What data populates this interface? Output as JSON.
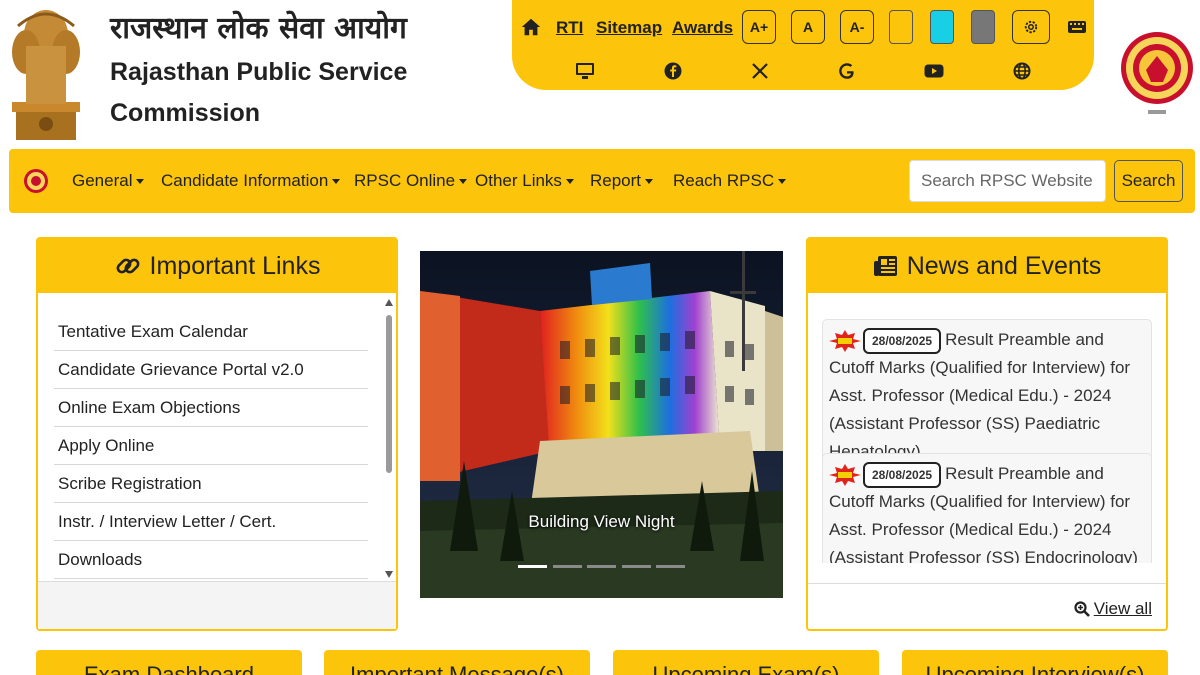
{
  "header": {
    "title_hindi": "राजस्थान लोक सेवा आयोग",
    "title_english": "Rajasthan Public Service Commission"
  },
  "topbar": {
    "links": [
      "RTI",
      "Sitemap",
      "Awards"
    ],
    "font_buttons": [
      "A+",
      "A",
      "A-"
    ],
    "theme_swatches": [
      "#fcc40a",
      "#19cfe6",
      "#777777"
    ],
    "icons_row1": [
      "home-icon",
      "gear-icon",
      "keyboard-icon"
    ],
    "icons_row2": [
      "desktop-icon",
      "facebook-icon",
      "x-icon",
      "google-icon",
      "youtube-icon",
      "globe-icon"
    ]
  },
  "nav": {
    "items": [
      "General",
      "Candidate Information",
      "RPSC Online",
      "Other Links",
      "Report",
      "Reach RPSC"
    ],
    "search_placeholder": "Search RPSC Website",
    "search_button": "Search"
  },
  "important_links": {
    "title": "Important Links",
    "items": [
      "Tentative Exam Calendar",
      "Candidate Grievance Portal v2.0",
      "Online Exam Objections",
      "Apply Online",
      "Scribe Registration",
      "Instr. / Interview Letter / Cert.",
      "Downloads"
    ]
  },
  "carousel": {
    "caption": "Building View Night",
    "slide_count": 5,
    "active_slide": 1
  },
  "news": {
    "title": "News and Events",
    "items": [
      {
        "date": "28/08/2025",
        "text": "Result Preamble and Cutoff Marks (Qualified for Interview) for Asst. Professor (Medical Edu.) - 2024 (Assistant Professor (SS) Paediatric Hepatology)"
      },
      {
        "date": "28/08/2025",
        "text": "Result Preamble and Cutoff Marks (Qualified for Interview) for Asst. Professor (Medical Edu.) - 2024 (Assistant Professor (SS) Endocrinology)"
      }
    ],
    "view_all": "View all"
  },
  "bottom_cards": [
    "Exam Dashboard",
    "Important Message(s)",
    "Upcoming Exam(s)",
    "Upcoming Interview(s)"
  ],
  "colors": {
    "accent": "#fcc40a"
  }
}
